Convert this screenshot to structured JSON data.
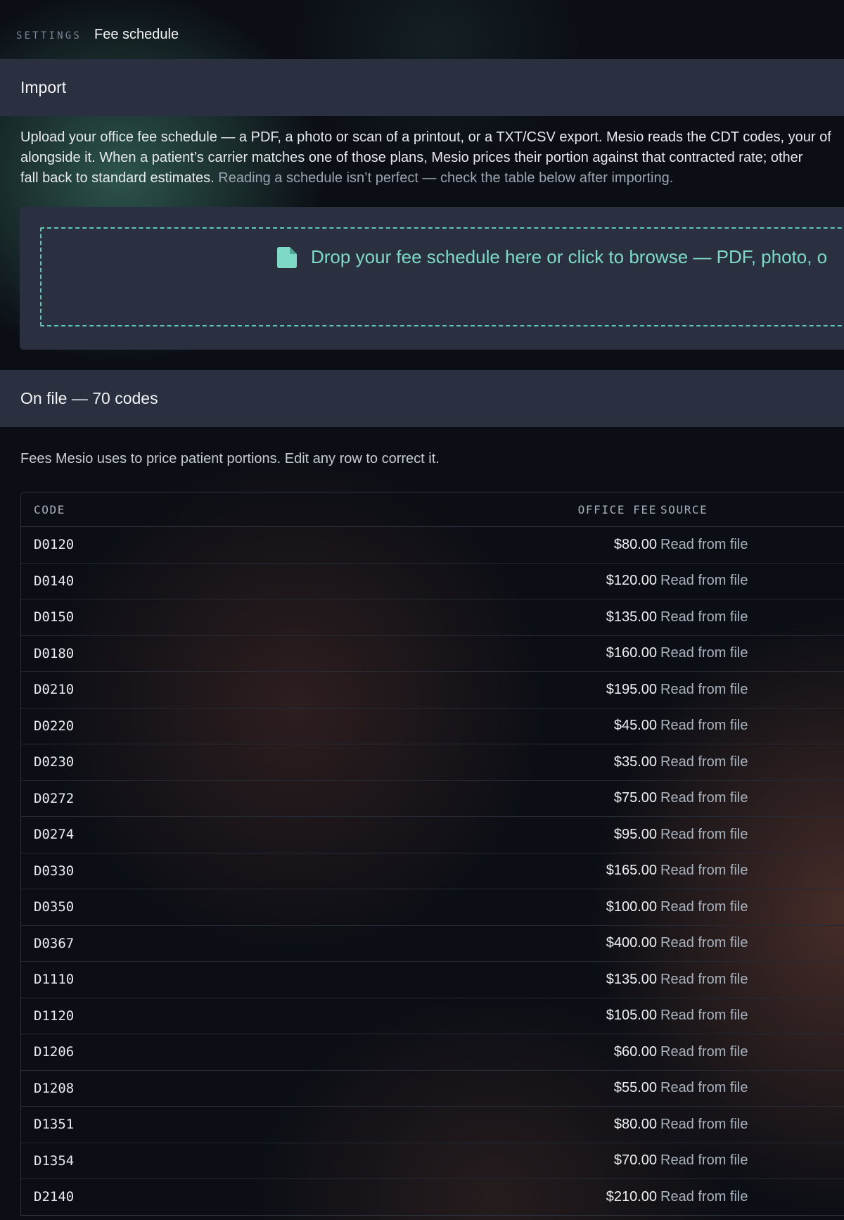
{
  "breadcrumb": {
    "section": "SETTINGS",
    "page": "Fee schedule"
  },
  "import_section": {
    "title": "Import",
    "description_lines": [
      "Upload your office fee schedule — a PDF, a photo or scan of a printout, or a TXT/CSV export. Mesio reads the CDT codes, your of",
      "alongside it. When a patient’s carrier matches one of those plans, Mesio prices their portion against that contracted rate; other",
      "fall back to standard estimates. "
    ],
    "description_note": "Reading a schedule isn’t perfect — check the table below after importing.",
    "dropzone_text": "Drop your fee schedule here or click to browse — PDF, photo, o",
    "dropzone_icon": "file-icon",
    "accent_color": "#7fd9c7"
  },
  "onfile_section": {
    "title": "On file — 70 codes",
    "description": "Fees Mesio uses to price patient portions. Edit any row to correct it."
  },
  "table": {
    "headers": {
      "code": "CODE",
      "office_fee": "OFFICE FEE",
      "source": "SOURCE"
    },
    "rows": [
      {
        "code": "D0120",
        "fee": "$80.00",
        "source": "Read from file"
      },
      {
        "code": "D0140",
        "fee": "$120.00",
        "source": "Read from file"
      },
      {
        "code": "D0150",
        "fee": "$135.00",
        "source": "Read from file"
      },
      {
        "code": "D0180",
        "fee": "$160.00",
        "source": "Read from file"
      },
      {
        "code": "D0210",
        "fee": "$195.00",
        "source": "Read from file"
      },
      {
        "code": "D0220",
        "fee": "$45.00",
        "source": "Read from file"
      },
      {
        "code": "D0230",
        "fee": "$35.00",
        "source": "Read from file"
      },
      {
        "code": "D0272",
        "fee": "$75.00",
        "source": "Read from file"
      },
      {
        "code": "D0274",
        "fee": "$95.00",
        "source": "Read from file"
      },
      {
        "code": "D0330",
        "fee": "$165.00",
        "source": "Read from file"
      },
      {
        "code": "D0350",
        "fee": "$100.00",
        "source": "Read from file"
      },
      {
        "code": "D0367",
        "fee": "$400.00",
        "source": "Read from file"
      },
      {
        "code": "D1110",
        "fee": "$135.00",
        "source": "Read from file"
      },
      {
        "code": "D1120",
        "fee": "$105.00",
        "source": "Read from file"
      },
      {
        "code": "D1206",
        "fee": "$60.00",
        "source": "Read from file"
      },
      {
        "code": "D1208",
        "fee": "$55.00",
        "source": "Read from file"
      },
      {
        "code": "D1351",
        "fee": "$80.00",
        "source": "Read from file"
      },
      {
        "code": "D1354",
        "fee": "$70.00",
        "source": "Read from file"
      },
      {
        "code": "D2140",
        "fee": "$210.00",
        "source": "Read from file"
      }
    ]
  }
}
